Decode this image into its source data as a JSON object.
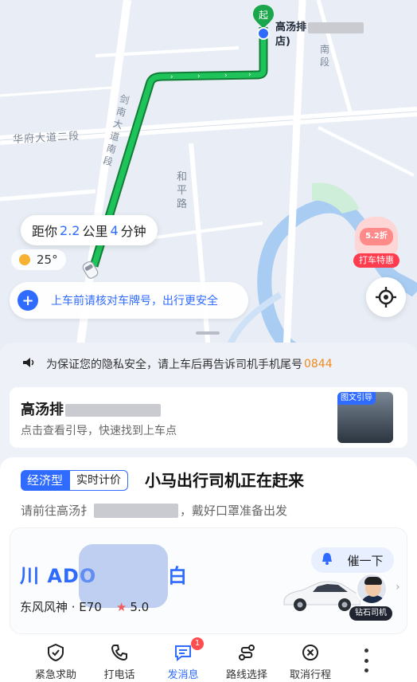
{
  "map": {
    "road_labels": [
      "华府大道二段",
      "剑南大道南段",
      "和平路",
      "南段"
    ],
    "start_marker": "起",
    "pickup_name_visible": "高汤排",
    "pickup_name_suffix": "店)",
    "distance": {
      "prefix": "距你",
      "km": "2.2",
      "km_unit": "公里",
      "minutes": "4",
      "min_unit": "分钟"
    },
    "temperature": "25°",
    "safety_tip": "上车前请核对车牌号，出行更安全",
    "promo_discount": "5.2折",
    "promo_label": "打车特惠",
    "icons": {
      "locate": "locate-icon",
      "shield": "shield-icon"
    }
  },
  "privacy": {
    "text": "为保证您的隐私安全，请上车后再告诉司机手机尾号",
    "code": "0844"
  },
  "guide": {
    "title": "高汤排",
    "subtitle": "点击查看引导，快速找到上车点",
    "thumb_tag": "图文引导"
  },
  "trip": {
    "type_badge": "经济型",
    "pricing_badge": "实时计价",
    "status": "小马出行司机正在赶来",
    "hint_prefix": "请前往高汤扌",
    "hint_suffix": "，戴好口罩准备出发"
  },
  "driver": {
    "plate_prefix": "川 ADO",
    "plate_suffix": "白",
    "car_model": "东风风神 · E70",
    "rating": "5.0",
    "urge_label": "催一下",
    "badge": "钻石司机"
  },
  "actions": [
    {
      "label": "紧急求助",
      "icon": "sos-icon"
    },
    {
      "label": "打电话",
      "icon": "phone-icon"
    },
    {
      "label": "发消息",
      "icon": "message-icon",
      "badge": "1"
    },
    {
      "label": "路线选择",
      "icon": "route-icon"
    },
    {
      "label": "取消行程",
      "icon": "cancel-icon"
    }
  ],
  "colors": {
    "accent": "#2f6bff",
    "route": "#1aa64b",
    "alert": "#ff4d4f",
    "code": "#f08a1e"
  }
}
